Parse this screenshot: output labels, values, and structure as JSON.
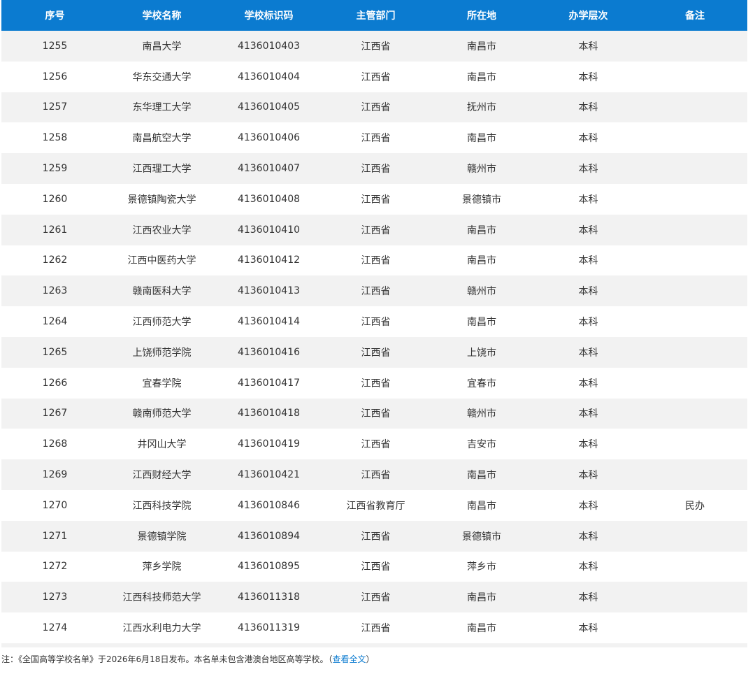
{
  "table": {
    "headers": [
      "序号",
      "学校名称",
      "学校标识码",
      "主管部门",
      "所在地",
      "办学层次",
      "备注"
    ],
    "rows": [
      [
        "1255",
        "南昌大学",
        "4136010403",
        "江西省",
        "南昌市",
        "本科",
        ""
      ],
      [
        "1256",
        "华东交通大学",
        "4136010404",
        "江西省",
        "南昌市",
        "本科",
        ""
      ],
      [
        "1257",
        "东华理工大学",
        "4136010405",
        "江西省",
        "抚州市",
        "本科",
        ""
      ],
      [
        "1258",
        "南昌航空大学",
        "4136010406",
        "江西省",
        "南昌市",
        "本科",
        ""
      ],
      [
        "1259",
        "江西理工大学",
        "4136010407",
        "江西省",
        "赣州市",
        "本科",
        ""
      ],
      [
        "1260",
        "景德镇陶瓷大学",
        "4136010408",
        "江西省",
        "景德镇市",
        "本科",
        ""
      ],
      [
        "1261",
        "江西农业大学",
        "4136010410",
        "江西省",
        "南昌市",
        "本科",
        ""
      ],
      [
        "1262",
        "江西中医药大学",
        "4136010412",
        "江西省",
        "南昌市",
        "本科",
        ""
      ],
      [
        "1263",
        "赣南医科大学",
        "4136010413",
        "江西省",
        "赣州市",
        "本科",
        ""
      ],
      [
        "1264",
        "江西师范大学",
        "4136010414",
        "江西省",
        "南昌市",
        "本科",
        ""
      ],
      [
        "1265",
        "上饶师范学院",
        "4136010416",
        "江西省",
        "上饶市",
        "本科",
        ""
      ],
      [
        "1266",
        "宜春学院",
        "4136010417",
        "江西省",
        "宜春市",
        "本科",
        ""
      ],
      [
        "1267",
        "赣南师范大学",
        "4136010418",
        "江西省",
        "赣州市",
        "本科",
        ""
      ],
      [
        "1268",
        "井冈山大学",
        "4136010419",
        "江西省",
        "吉安市",
        "本科",
        ""
      ],
      [
        "1269",
        "江西财经大学",
        "4136010421",
        "江西省",
        "南昌市",
        "本科",
        ""
      ],
      [
        "1270",
        "江西科技学院",
        "4136010846",
        "江西省教育厅",
        "南昌市",
        "本科",
        "民办"
      ],
      [
        "1271",
        "景德镇学院",
        "4136010894",
        "江西省",
        "景德镇市",
        "本科",
        ""
      ],
      [
        "1272",
        "萍乡学院",
        "4136010895",
        "江西省",
        "萍乡市",
        "本科",
        ""
      ],
      [
        "1273",
        "江西科技师范大学",
        "4136011318",
        "江西省",
        "南昌市",
        "本科",
        ""
      ],
      [
        "1274",
        "江西水利电力大学",
        "4136011319",
        "江西省",
        "南昌市",
        "本科",
        ""
      ]
    ]
  },
  "note": {
    "text": "注：《全国高等学校名单》于2026年6月18日发布。本名单未包含港澳台地区高等学校。（",
    "link_label": "查看全文",
    "close": "）"
  },
  "colors": {
    "header_bg": "#0b7bd0",
    "header_text": "#ffffff",
    "row_stripe": "#f2f2f2",
    "link": "#0b7bd0"
  }
}
